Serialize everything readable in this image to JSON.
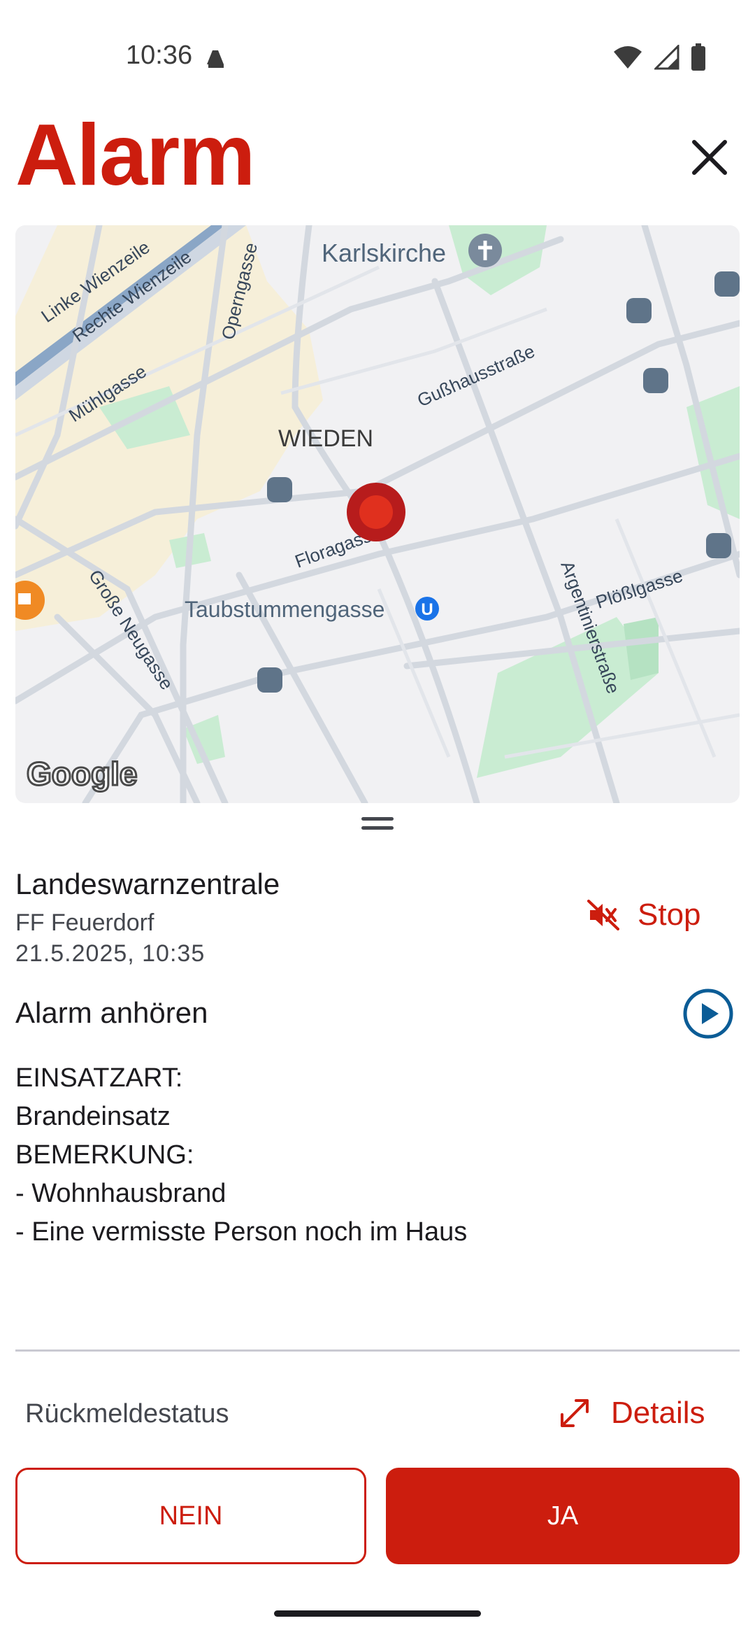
{
  "status_bar": {
    "time": "10:36"
  },
  "header": {
    "title": "Alarm"
  },
  "map": {
    "labels": {
      "karlskirche": "Karlskirche",
      "linke_wienzeile": "Linke Wienzeile",
      "rechte_wienzeile": "Rechte Wienzeile",
      "operngasse": "Operngasse",
      "muehlgasse": "Mühlgasse",
      "gusshausstrasse": "Gußhausstraße",
      "wieden": "WIEDEN",
      "floragasse": "Floragasse",
      "taubstummengasse": "Taubstummengasse",
      "grosse_neugasse": "Große Neugasse",
      "argentinierstrasse": "Argentinierstraße",
      "ploesslgasse": "Plößlgasse",
      "attribution": "Google"
    }
  },
  "alarm": {
    "sender": "Landeswarnzentrale",
    "unit": "FF Feuerdorf",
    "datetime": "21.5.2025, 10:35",
    "stop_label": "Stop",
    "listen_label": "Alarm anhören",
    "message_lines": [
      "EINSATZART:",
      "Brandeinsatz",
      "BEMERKUNG:",
      "- Wohnhausbrand",
      "- Eine vermisste Person noch im Haus"
    ]
  },
  "feedback": {
    "label": "Rückmeldestatus",
    "details_label": "Details",
    "no_label": "NEIN",
    "yes_label": "JA"
  },
  "colors": {
    "accent": "#cc1d0e",
    "play": "#0b5c96",
    "park": "#c9ecd2",
    "road": "#d3d8df"
  }
}
